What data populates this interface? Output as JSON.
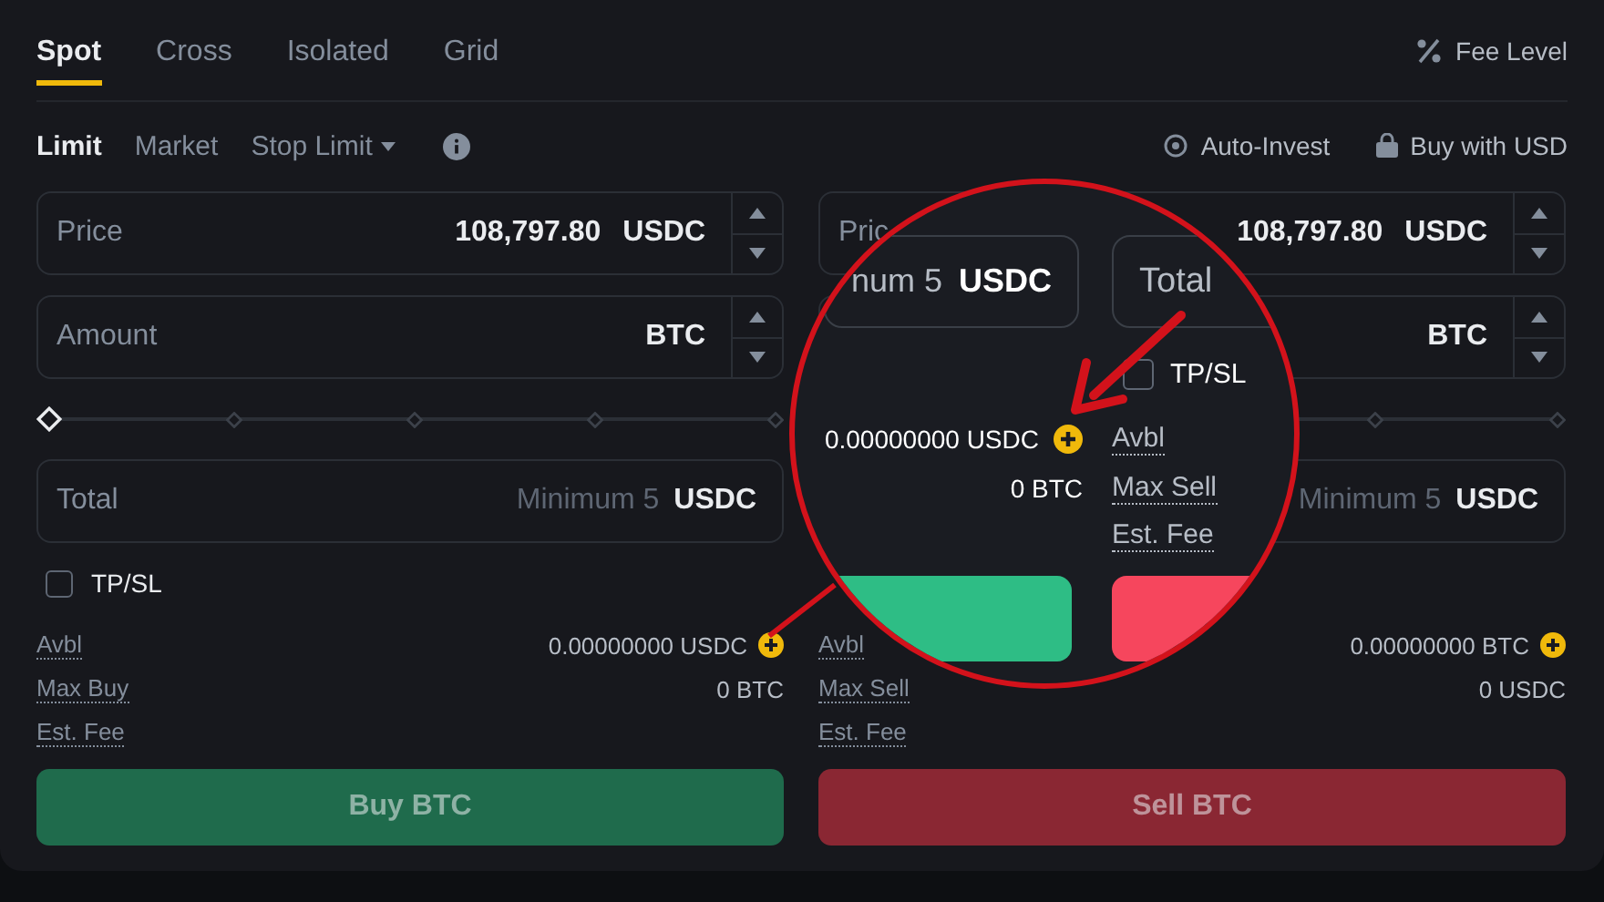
{
  "tabs": [
    {
      "label": "Spot",
      "selected": true
    },
    {
      "label": "Cross",
      "selected": false
    },
    {
      "label": "Isolated",
      "selected": false
    },
    {
      "label": "Grid",
      "selected": false
    }
  ],
  "fee_level": "Fee Level",
  "order_types": [
    {
      "label": "Limit",
      "selected": true,
      "caret": false
    },
    {
      "label": "Market",
      "selected": false,
      "caret": false
    },
    {
      "label": "Stop Limit",
      "selected": false,
      "caret": true
    }
  ],
  "links": [
    {
      "kind": "auto",
      "label": "Auto-Invest"
    },
    {
      "kind": "buy",
      "label": "Buy with USD"
    }
  ],
  "buy": {
    "price": {
      "label": "Price",
      "value": "108,797.80",
      "unit": "USDC"
    },
    "amount": {
      "label": "Amount",
      "unit": "BTC"
    },
    "slider": {
      "level": 0
    },
    "total": {
      "label": "Total",
      "placeholder": "Minimum 5",
      "unit": "USDC"
    },
    "tpsl": {
      "label": "TP/SL",
      "checked": false
    },
    "info": [
      {
        "label": "Avbl",
        "value": "0.00000000 USDC",
        "plus": true
      },
      {
        "label": "Max Buy",
        "value": "0 BTC",
        "plus": false
      },
      {
        "label": "Est. Fee",
        "plus": false
      }
    ],
    "button": "Buy BTC"
  },
  "sell": {
    "price": {
      "label": "Pric",
      "value": "108,797.80",
      "unit": "USDC"
    },
    "amount": {
      "unit": "BTC"
    },
    "total": {
      "placeholder": "Minimum 5",
      "unit": "USDC"
    },
    "info": [
      {
        "label": "Avbl",
        "value": "0.00000000 BTC",
        "plus": true
      },
      {
        "label": "Max Sell",
        "value": "0 USDC",
        "plus": false
      },
      {
        "label": "Est. Fee",
        "plus": false
      }
    ],
    "button": "Sell BTC"
  },
  "magnifier": {
    "buy_total": {
      "placeholder": "num 5",
      "unit": "USDC"
    },
    "sell_total": {
      "label": "Total"
    },
    "tpsl": {
      "label": "TP/SL",
      "checked": false
    },
    "values": [
      {
        "value": "0.00000000 USDC",
        "plus": true
      },
      {
        "value": "0 BTC",
        "plus": false
      }
    ],
    "labels": [
      "Avbl",
      "Max Sell",
      "Est. Fee"
    ]
  }
}
